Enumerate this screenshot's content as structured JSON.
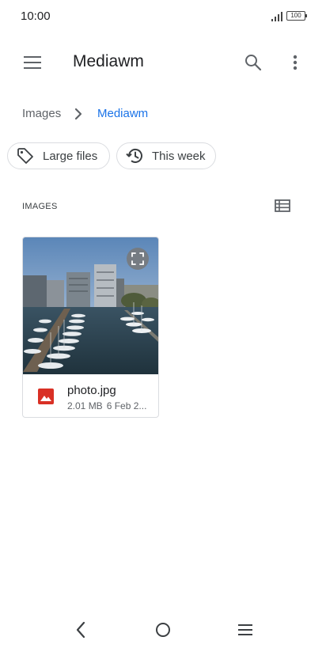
{
  "status_bar": {
    "time": "10:00",
    "battery": "100"
  },
  "app_bar": {
    "title": "Mediawm",
    "icons": [
      "menu-icon",
      "search-icon",
      "more-vert-icon"
    ]
  },
  "breadcrumb": {
    "root": "Images",
    "current": "Mediawm"
  },
  "filters": [
    {
      "label": "Large files",
      "icon": "tag-icon"
    },
    {
      "label": "This week",
      "icon": "history-icon"
    }
  ],
  "section": {
    "label": "IMAGES",
    "view_icon": "list-view-icon"
  },
  "files": [
    {
      "name": "photo.jpg",
      "size": "2.01 MB",
      "date": "6 Feb 2..."
    }
  ],
  "navigation": {
    "icons": [
      "back-icon",
      "home-icon",
      "recents-icon"
    ]
  },
  "colors": {
    "accent": "#1a73e8",
    "image_icon": "#d93025",
    "chip_border": "#dadce0"
  }
}
